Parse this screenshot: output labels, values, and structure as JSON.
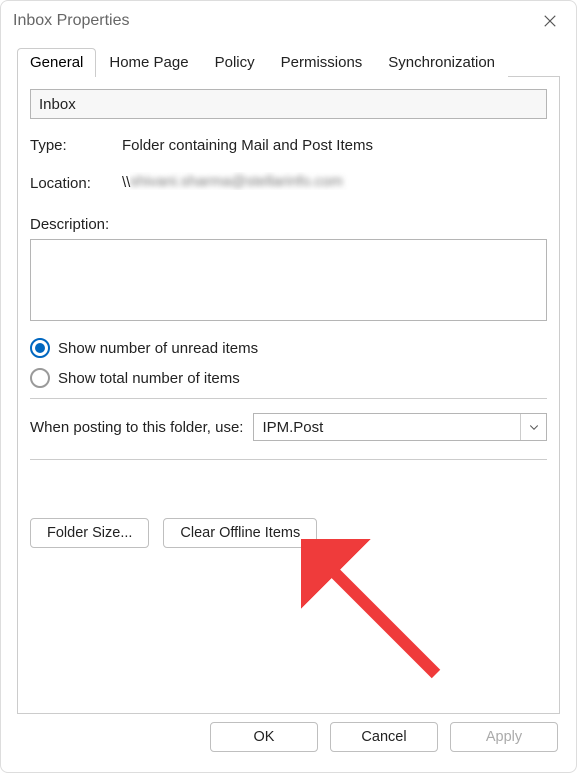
{
  "window": {
    "title": "Inbox Properties"
  },
  "tabs": [
    {
      "label": "General"
    },
    {
      "label": "Home Page"
    },
    {
      "label": "Policy"
    },
    {
      "label": "Permissions"
    },
    {
      "label": "Synchronization"
    }
  ],
  "active_tab_index": 0,
  "general": {
    "folder_name": "Inbox",
    "type_label": "Type:",
    "type_value": "Folder containing Mail and Post Items",
    "location_label": "Location:",
    "location_prefix": "\\\\",
    "location_value_redacted": true,
    "description_label": "Description:",
    "description_value": "",
    "radios": {
      "unread_label": "Show number of unread items",
      "total_label": "Show total number of items",
      "selected": "unread"
    },
    "posting_label": "When posting to this folder, use:",
    "posting_value": "IPM.Post",
    "buttons": {
      "folder_size": "Folder Size...",
      "clear_offline": "Clear Offline Items"
    }
  },
  "footer": {
    "ok": "OK",
    "cancel": "Cancel",
    "apply": "Apply",
    "apply_enabled": false
  },
  "annotation": {
    "arrow_color": "#ef3b3b",
    "points_to": "clear-offline-button"
  }
}
